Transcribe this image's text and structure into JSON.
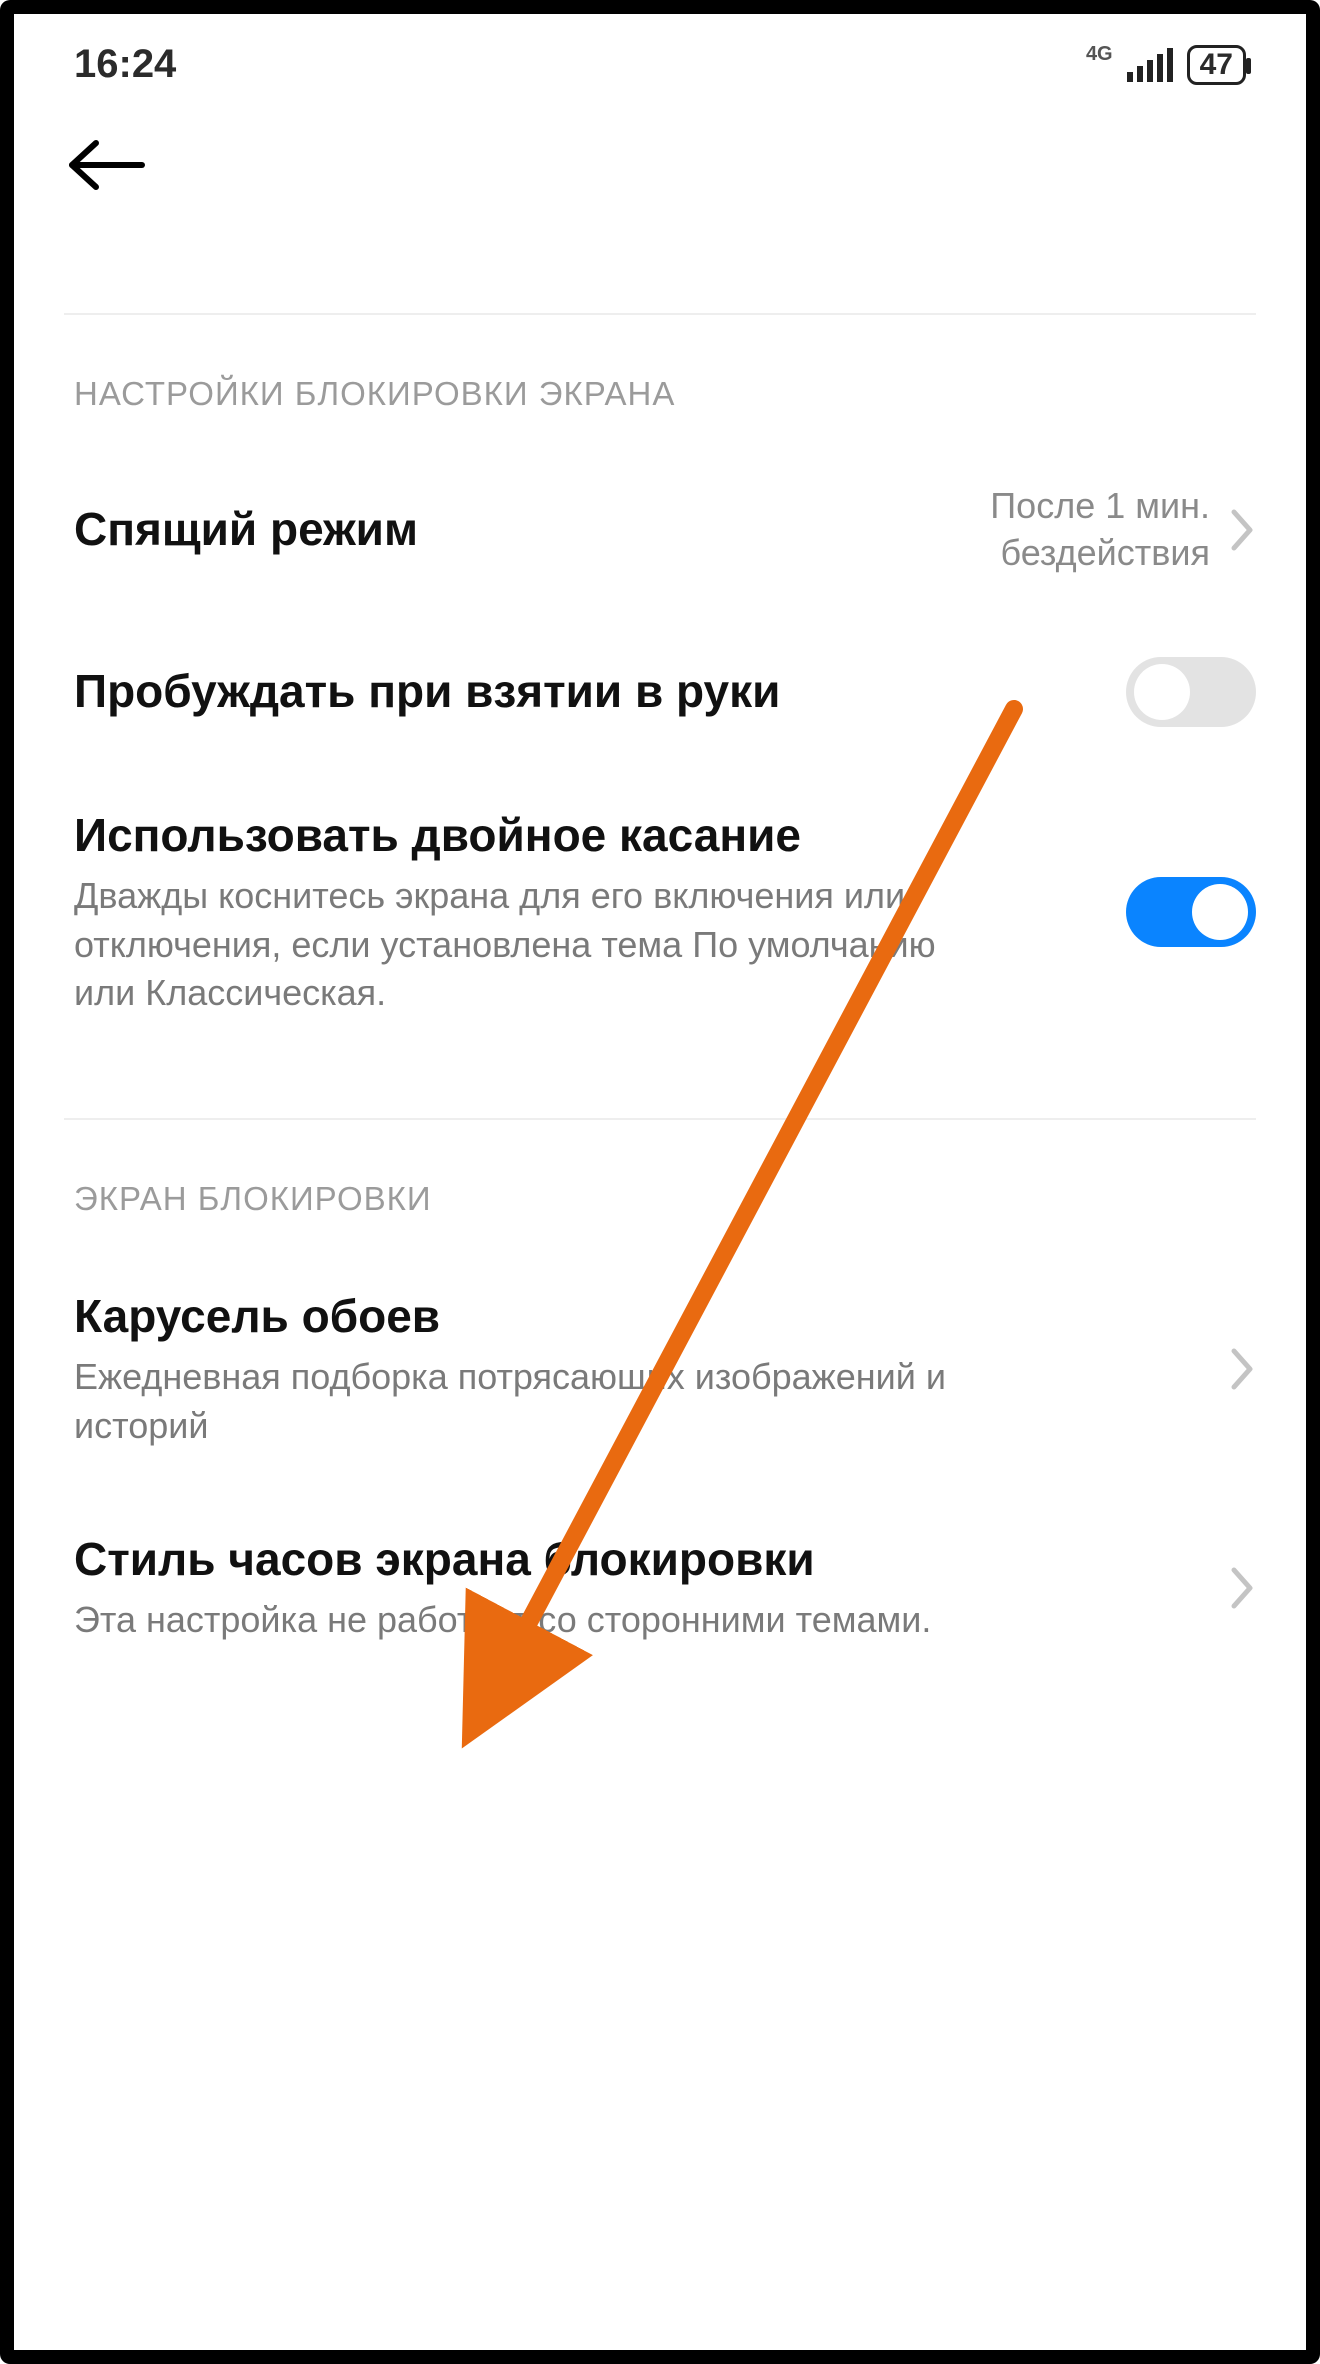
{
  "status": {
    "time": "16:24",
    "network_label": "4G",
    "battery_text": "47"
  },
  "sections": {
    "lock_settings_header": "НАСТРОЙКИ БЛОКИРОВКИ ЭКРАНА",
    "lock_screen_header": "ЭКРАН БЛОКИРОВКИ"
  },
  "rows": {
    "sleep": {
      "title": "Спящий режим",
      "value_line1": "После 1 мин.",
      "value_line2": "бездействия"
    },
    "raise_wake": {
      "title": "Пробуждать при взятии в руки"
    },
    "double_tap": {
      "title": "Использовать двойное касание",
      "sub": "Дважды коснитесь экрана для его включения или отключения, если установлена тема По умолчанию или Классическая."
    },
    "carousel": {
      "title": "Карусель обоев",
      "sub": "Ежедневная подборка потрясающих изображений и историй"
    },
    "clock_style": {
      "title": "Стиль часов экрана блокировки",
      "sub": "Эта настройка не работает со сторонними темами."
    }
  }
}
